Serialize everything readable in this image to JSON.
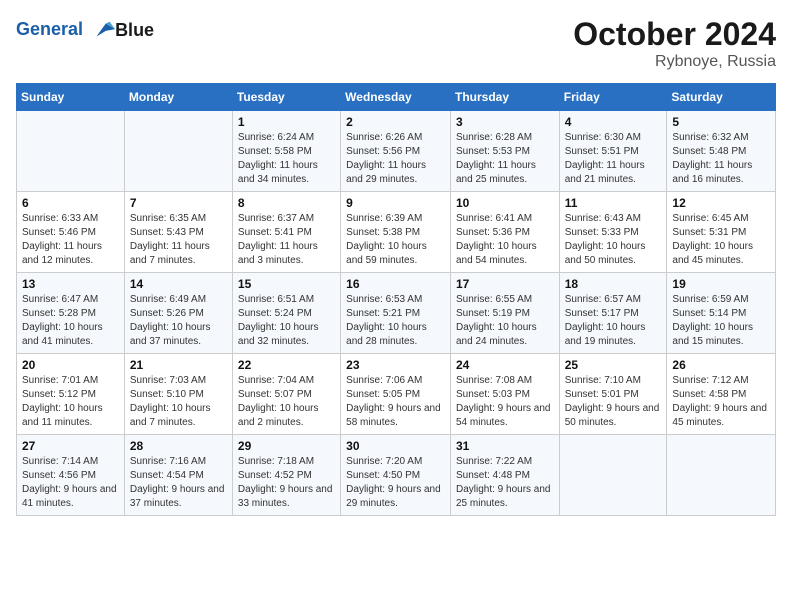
{
  "logo": {
    "line1": "General",
    "line2": "Blue"
  },
  "title": "October 2024",
  "location": "Rybnoye, Russia",
  "days_header": [
    "Sunday",
    "Monday",
    "Tuesday",
    "Wednesday",
    "Thursday",
    "Friday",
    "Saturday"
  ],
  "weeks": [
    [
      {
        "day": "",
        "info": ""
      },
      {
        "day": "",
        "info": ""
      },
      {
        "day": "1",
        "info": "Sunrise: 6:24 AM\nSunset: 5:58 PM\nDaylight: 11 hours and 34 minutes."
      },
      {
        "day": "2",
        "info": "Sunrise: 6:26 AM\nSunset: 5:56 PM\nDaylight: 11 hours and 29 minutes."
      },
      {
        "day": "3",
        "info": "Sunrise: 6:28 AM\nSunset: 5:53 PM\nDaylight: 11 hours and 25 minutes."
      },
      {
        "day": "4",
        "info": "Sunrise: 6:30 AM\nSunset: 5:51 PM\nDaylight: 11 hours and 21 minutes."
      },
      {
        "day": "5",
        "info": "Sunrise: 6:32 AM\nSunset: 5:48 PM\nDaylight: 11 hours and 16 minutes."
      }
    ],
    [
      {
        "day": "6",
        "info": "Sunrise: 6:33 AM\nSunset: 5:46 PM\nDaylight: 11 hours and 12 minutes."
      },
      {
        "day": "7",
        "info": "Sunrise: 6:35 AM\nSunset: 5:43 PM\nDaylight: 11 hours and 7 minutes."
      },
      {
        "day": "8",
        "info": "Sunrise: 6:37 AM\nSunset: 5:41 PM\nDaylight: 11 hours and 3 minutes."
      },
      {
        "day": "9",
        "info": "Sunrise: 6:39 AM\nSunset: 5:38 PM\nDaylight: 10 hours and 59 minutes."
      },
      {
        "day": "10",
        "info": "Sunrise: 6:41 AM\nSunset: 5:36 PM\nDaylight: 10 hours and 54 minutes."
      },
      {
        "day": "11",
        "info": "Sunrise: 6:43 AM\nSunset: 5:33 PM\nDaylight: 10 hours and 50 minutes."
      },
      {
        "day": "12",
        "info": "Sunrise: 6:45 AM\nSunset: 5:31 PM\nDaylight: 10 hours and 45 minutes."
      }
    ],
    [
      {
        "day": "13",
        "info": "Sunrise: 6:47 AM\nSunset: 5:28 PM\nDaylight: 10 hours and 41 minutes."
      },
      {
        "day": "14",
        "info": "Sunrise: 6:49 AM\nSunset: 5:26 PM\nDaylight: 10 hours and 37 minutes."
      },
      {
        "day": "15",
        "info": "Sunrise: 6:51 AM\nSunset: 5:24 PM\nDaylight: 10 hours and 32 minutes."
      },
      {
        "day": "16",
        "info": "Sunrise: 6:53 AM\nSunset: 5:21 PM\nDaylight: 10 hours and 28 minutes."
      },
      {
        "day": "17",
        "info": "Sunrise: 6:55 AM\nSunset: 5:19 PM\nDaylight: 10 hours and 24 minutes."
      },
      {
        "day": "18",
        "info": "Sunrise: 6:57 AM\nSunset: 5:17 PM\nDaylight: 10 hours and 19 minutes."
      },
      {
        "day": "19",
        "info": "Sunrise: 6:59 AM\nSunset: 5:14 PM\nDaylight: 10 hours and 15 minutes."
      }
    ],
    [
      {
        "day": "20",
        "info": "Sunrise: 7:01 AM\nSunset: 5:12 PM\nDaylight: 10 hours and 11 minutes."
      },
      {
        "day": "21",
        "info": "Sunrise: 7:03 AM\nSunset: 5:10 PM\nDaylight: 10 hours and 7 minutes."
      },
      {
        "day": "22",
        "info": "Sunrise: 7:04 AM\nSunset: 5:07 PM\nDaylight: 10 hours and 2 minutes."
      },
      {
        "day": "23",
        "info": "Sunrise: 7:06 AM\nSunset: 5:05 PM\nDaylight: 9 hours and 58 minutes."
      },
      {
        "day": "24",
        "info": "Sunrise: 7:08 AM\nSunset: 5:03 PM\nDaylight: 9 hours and 54 minutes."
      },
      {
        "day": "25",
        "info": "Sunrise: 7:10 AM\nSunset: 5:01 PM\nDaylight: 9 hours and 50 minutes."
      },
      {
        "day": "26",
        "info": "Sunrise: 7:12 AM\nSunset: 4:58 PM\nDaylight: 9 hours and 45 minutes."
      }
    ],
    [
      {
        "day": "27",
        "info": "Sunrise: 7:14 AM\nSunset: 4:56 PM\nDaylight: 9 hours and 41 minutes."
      },
      {
        "day": "28",
        "info": "Sunrise: 7:16 AM\nSunset: 4:54 PM\nDaylight: 9 hours and 37 minutes."
      },
      {
        "day": "29",
        "info": "Sunrise: 7:18 AM\nSunset: 4:52 PM\nDaylight: 9 hours and 33 minutes."
      },
      {
        "day": "30",
        "info": "Sunrise: 7:20 AM\nSunset: 4:50 PM\nDaylight: 9 hours and 29 minutes."
      },
      {
        "day": "31",
        "info": "Sunrise: 7:22 AM\nSunset: 4:48 PM\nDaylight: 9 hours and 25 minutes."
      },
      {
        "day": "",
        "info": ""
      },
      {
        "day": "",
        "info": ""
      }
    ]
  ]
}
